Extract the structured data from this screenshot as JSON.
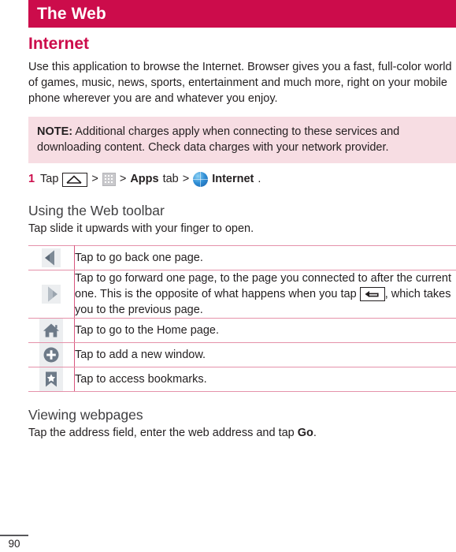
{
  "chapter": {
    "title": "The Web"
  },
  "section": {
    "title": "Internet",
    "intro": "Use this application to browse the Internet. Browser gives you a fast, full-color world of games, music, news, sports, entertainment and much more, right on your mobile phone wherever you are and whatever you enjoy."
  },
  "note": {
    "label": "NOTE:",
    "text": "Additional charges apply when connecting to these services and downloading content. Check data charges with your network provider."
  },
  "step": {
    "number": "1",
    "verb": "Tap",
    "sep1": ">",
    "sep2": ">",
    "apps_label": "Apps",
    "tab_label": "tab",
    "sep3": ">",
    "internet_label": "Internet",
    "period": ".",
    "home_key_icon": "home-key-icon",
    "apps_grid_icon": "apps-grid-icon",
    "internet_globe_icon": "globe-icon"
  },
  "toolbar_section": {
    "title": "Using the Web toolbar",
    "subtitle": "Tap slide it upwards with your finger to open.",
    "rows": [
      {
        "icon": "back-arrow-icon",
        "text": "Tap to go back one page."
      },
      {
        "icon": "forward-arrow-icon",
        "text_part1": "Tap to go forward one page, to the page you connected to after the current one. This is the opposite of what happens when you tap",
        "inline_icon": "back-key-icon",
        "text_part2": ", which takes you to the previous page."
      },
      {
        "icon": "home-icon",
        "text": "Tap to go to the Home page."
      },
      {
        "icon": "plus-circle-icon",
        "text": "Tap to add a new window."
      },
      {
        "icon": "bookmark-star-icon",
        "text": "Tap to access bookmarks."
      }
    ]
  },
  "viewing_section": {
    "title": "Viewing webpages",
    "text_before": "Tap the address field, enter the web address and tap",
    "go_label": "Go",
    "text_after": "."
  },
  "footer": {
    "page_number": "90"
  },
  "colors": {
    "brand": "#cc0c4b",
    "note_bg": "#f7dde3",
    "table_border": "#e592aa",
    "column_rule": "#d9577f"
  }
}
